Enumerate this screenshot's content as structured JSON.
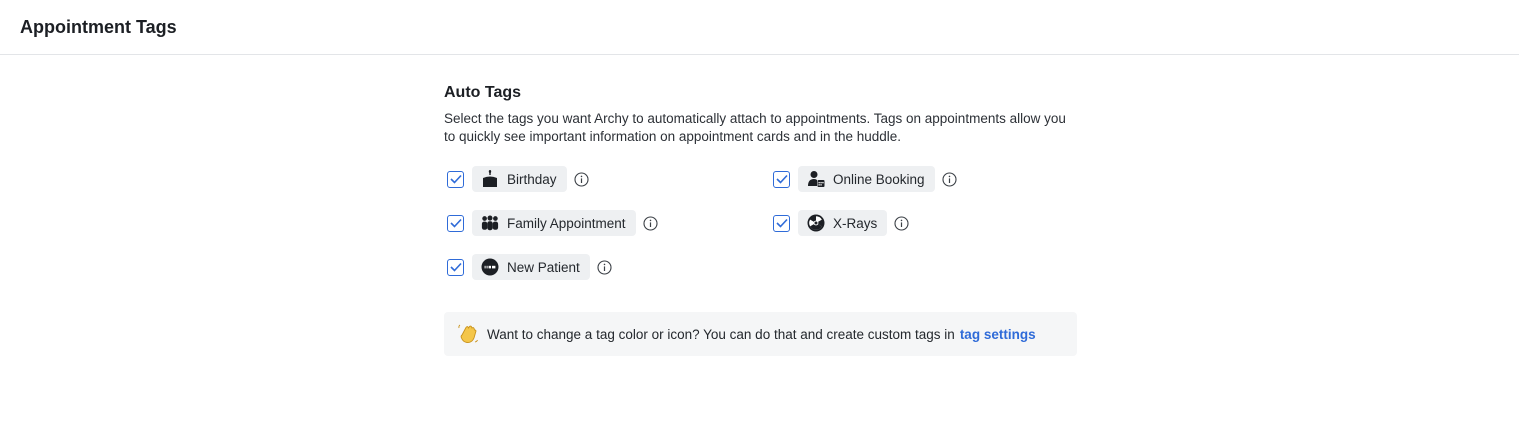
{
  "header": {
    "title": "Appointment Tags"
  },
  "auto_tags": {
    "title": "Auto Tags",
    "description": "Select the tags you want Archy to automatically attach to appointments. Tags on appointments allow you to quickly see important information on appointment cards and in the huddle.",
    "tags": [
      {
        "label": "Birthday",
        "checked": true,
        "icon": "cake-icon"
      },
      {
        "label": "Online Booking",
        "checked": true,
        "icon": "online-booking-icon"
      },
      {
        "label": "Family Appointment",
        "checked": true,
        "icon": "family-icon"
      },
      {
        "label": "X-Rays",
        "checked": true,
        "icon": "radiation-icon"
      },
      {
        "label": "New Patient",
        "checked": true,
        "icon": "new-badge-icon"
      }
    ]
  },
  "notice": {
    "icon": "waving-hand-icon",
    "text": "Want to change a tag color or icon? You can do that and create custom tags in",
    "link_label": "tag settings"
  },
  "colors": {
    "accent": "#2f6bd8",
    "chip_bg": "#eef0f2",
    "notice_bg": "#f5f6f7"
  }
}
